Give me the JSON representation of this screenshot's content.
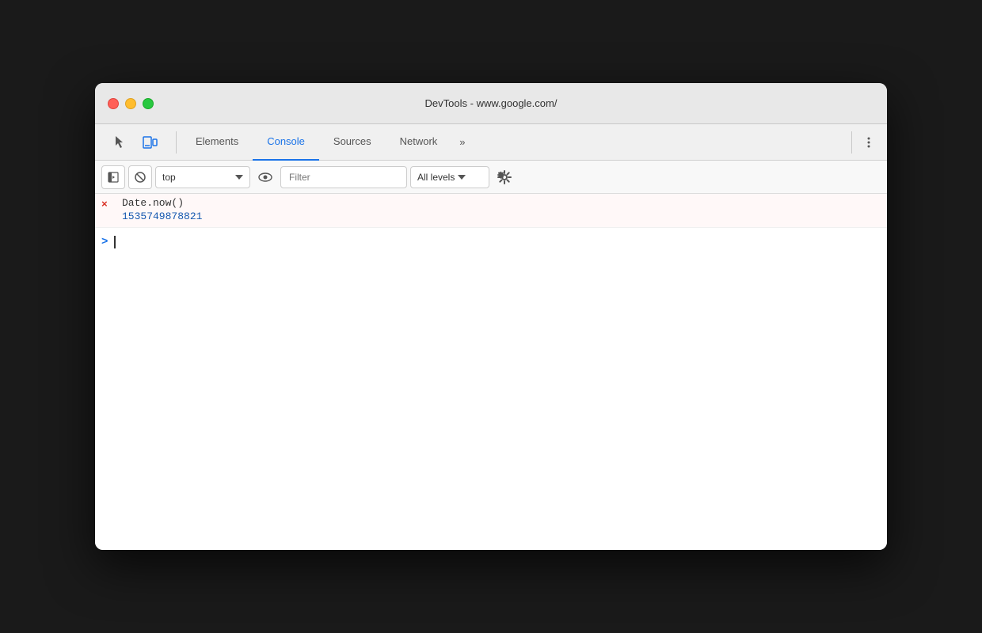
{
  "window": {
    "title": "DevTools - www.google.com/"
  },
  "traffic_lights": {
    "close_label": "close",
    "minimize_label": "minimize",
    "maximize_label": "maximize"
  },
  "tabs": {
    "items": [
      {
        "id": "elements",
        "label": "Elements",
        "active": false
      },
      {
        "id": "console",
        "label": "Console",
        "active": true
      },
      {
        "id": "sources",
        "label": "Sources",
        "active": false
      },
      {
        "id": "network",
        "label": "Network",
        "active": false
      }
    ],
    "more_label": "»",
    "more_options_label": "⋮"
  },
  "toolbar": {
    "context_value": "top",
    "context_placeholder": "top",
    "filter_placeholder": "Filter",
    "levels_label": "All levels",
    "eye_icon": "👁",
    "chevron_down": "▼"
  },
  "console": {
    "entry": {
      "error_icon": "×",
      "command_text": "Date.now()",
      "result_text": "1535749878821"
    },
    "prompt_symbol": ">"
  },
  "colors": {
    "active_tab": "#1a73e8",
    "result_blue": "#1558b0",
    "error_red": "#d93025",
    "border": "#d0d0d0"
  }
}
